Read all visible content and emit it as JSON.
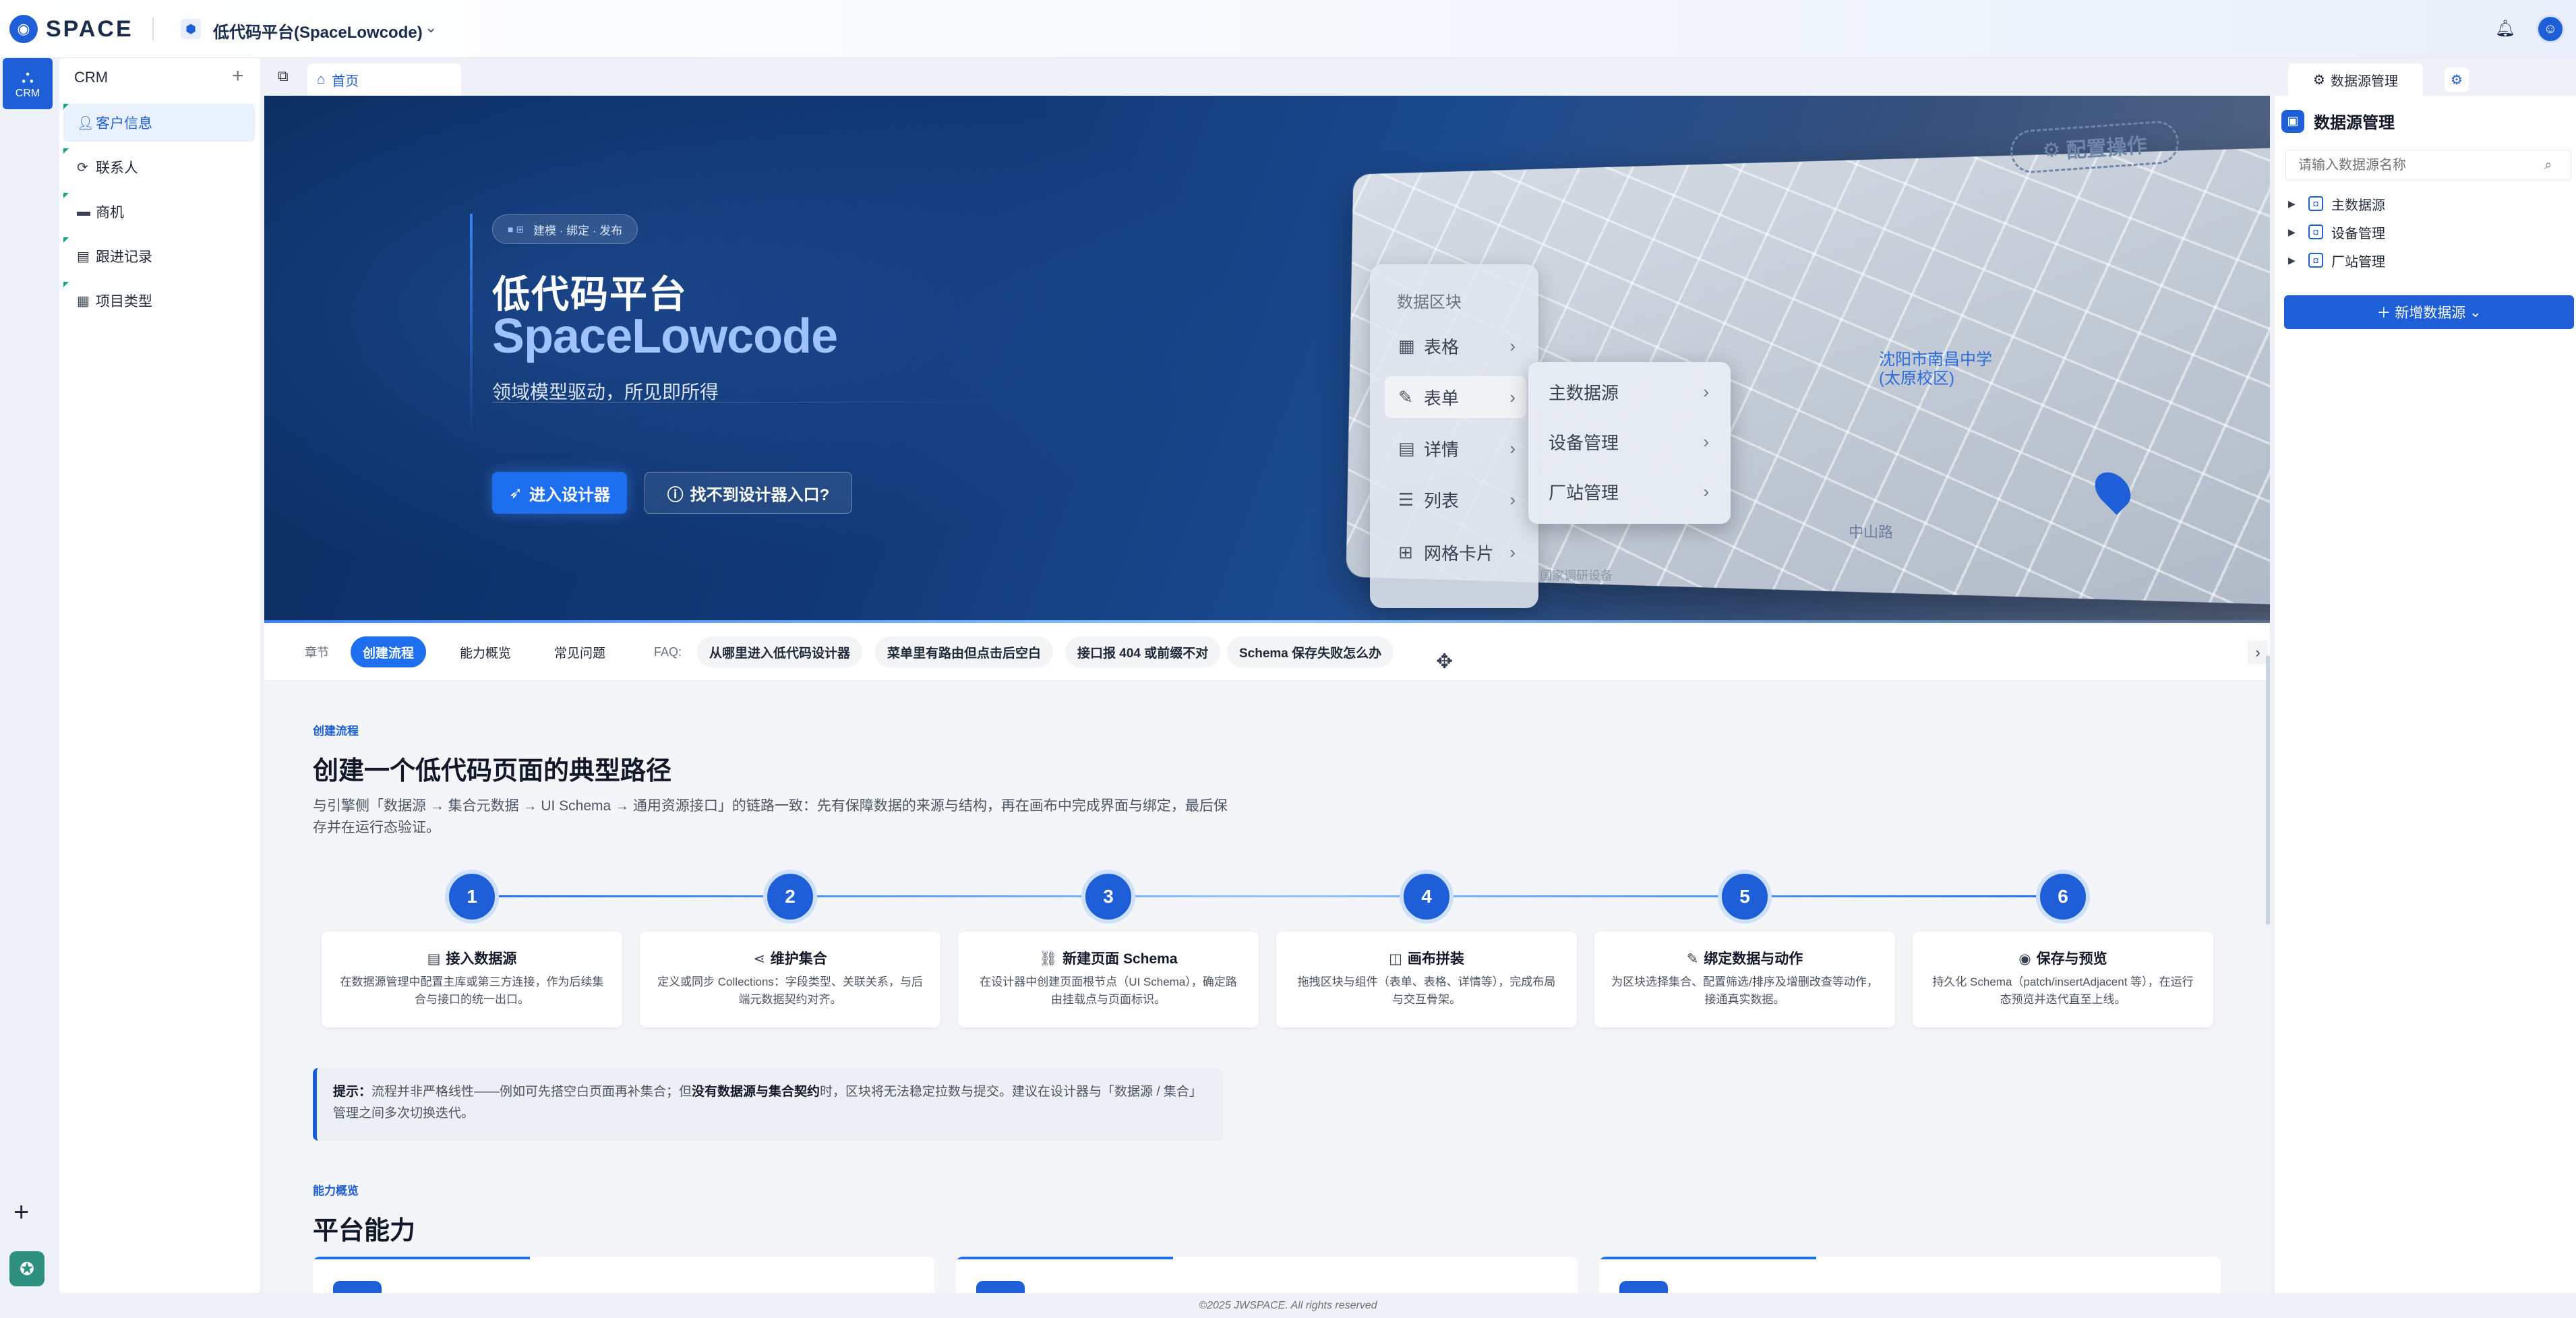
{
  "topbar": {
    "logo_text": "SPACE",
    "app_name": "低代码平台(SpaceLowcode)",
    "caret": "⌄"
  },
  "rail": {
    "crm_label": "CRM",
    "plus": "+"
  },
  "sidebar": {
    "title": "CRM",
    "plus": "+",
    "items": [
      {
        "label": "客户信息",
        "icon": "user-icon"
      },
      {
        "label": "联系人",
        "icon": "contact-icon"
      },
      {
        "label": "商机",
        "icon": "opportunity-icon"
      },
      {
        "label": "跟进记录",
        "icon": "clipboard-icon"
      },
      {
        "label": "项目类型",
        "icon": "box-icon"
      }
    ]
  },
  "tabs": {
    "home": "首页"
  },
  "hero": {
    "pill": "建模 · 绑定 · 发布",
    "title": "低代码平台",
    "subtitle": "SpaceLowcode",
    "desc": "领域模型驱动，所见即所得",
    "btn_primary": "进入设计器",
    "btn_ghost": "找不到设计器入口?",
    "preview": {
      "config_badge": "配置操作",
      "menu_header": "数据区块",
      "menu_items": [
        "表格",
        "表单",
        "详情",
        "列表",
        "网格卡片"
      ],
      "submenu_items": [
        "主数据源",
        "设备管理",
        "厂站管理"
      ],
      "map_label": "沈阳市南昌中学",
      "map_label_b": "(太原校区)",
      "map_label2": "中山路",
      "map_label3": "国家调研设备"
    }
  },
  "chapter_nav": {
    "label": "章节",
    "items": [
      "创建流程",
      "能力概览",
      "常见问题"
    ],
    "active": "创建流程",
    "faq_label": "FAQ:",
    "faqs": [
      "从哪里进入低代码设计器",
      "菜单里有路由但点击后空白",
      "接口报 404 或前缀不对",
      "Schema 保存失败怎么办"
    ],
    "more_arrow": "›"
  },
  "flow": {
    "tag": "创建流程",
    "heading": "创建一个低代码页面的典型路径",
    "description": "与引擎侧「数据源 → 集合元数据 → UI Schema → 通用资源接口」的链路一致：先有保障数据的来源与结构，再在画布中完成界面与绑定，最后保存并在运行态验证。",
    "steps": [
      {
        "num": "1",
        "title": "接入数据源",
        "icon": "database-icon",
        "desc": "在数据源管理中配置主库或第三方连接，作为后续集合与接口的统一出口。"
      },
      {
        "num": "2",
        "title": "维护集合",
        "icon": "share-icon",
        "desc": "定义或同步 Collections：字段类型、关联关系，与后端元数据契约对齐。"
      },
      {
        "num": "3",
        "title": "新建页面 Schema",
        "icon": "link-icon",
        "desc": "在设计器中创建页面根节点（UI Schema），确定路由挂载点与页面标识。"
      },
      {
        "num": "4",
        "title": "画布拼装",
        "icon": "layout-icon",
        "desc": "拖拽区块与组件（表单、表格、详情等），完成布局与交互骨架。"
      },
      {
        "num": "5",
        "title": "绑定数据与动作",
        "icon": "edit-icon",
        "desc": "为区块选择集合、配置筛选/排序及增删改查等动作，接通真实数据。"
      },
      {
        "num": "6",
        "title": "保存与预览",
        "icon": "eye-icon",
        "desc": "持久化 Schema（patch/insertAdjacent 等），在运行态预览并迭代直至上线。"
      }
    ],
    "tip_prefix": "提示：",
    "tip_text_a": "流程并非严格线性——例如可先搭空白页面再补集合；但",
    "tip_bold": "没有数据源与集合契约",
    "tip_text_b": "时，区块将无法稳定拉数与提交。建议在设计器与「数据源 / 集合」管理之间多次切换迭代。"
  },
  "capabilities": {
    "tag": "能力概览",
    "heading": "平台能力"
  },
  "right_panel": {
    "tab_label": "数据源管理",
    "title": "数据源管理",
    "search_placeholder": "请输入数据源名称",
    "tree": [
      "主数据源",
      "设备管理",
      "厂站管理"
    ],
    "add_button": "新增数据源"
  },
  "footer": {
    "text": "©2025 JWSPACE. All rights reserved"
  }
}
